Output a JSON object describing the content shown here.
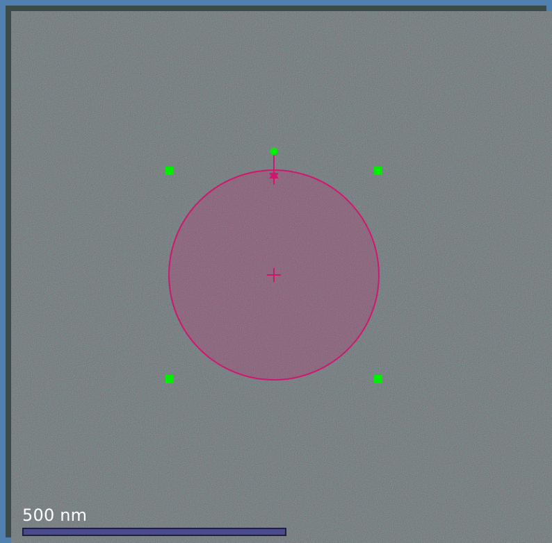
{
  "viewer": {
    "scale_bar_label": "500 nm"
  },
  "roi": {
    "shape": "circle",
    "stroke_color": "#d0166e",
    "fill_color": "#d0166e",
    "handle_color": "#00ee00"
  },
  "icons": {
    "center_marker": "crosshair-icon",
    "rotate_handle": "rotate-handle-icon",
    "resize_handles": [
      "resize-handle-icon",
      "resize-handle-icon",
      "resize-handle-icon",
      "resize-handle-icon"
    ]
  }
}
